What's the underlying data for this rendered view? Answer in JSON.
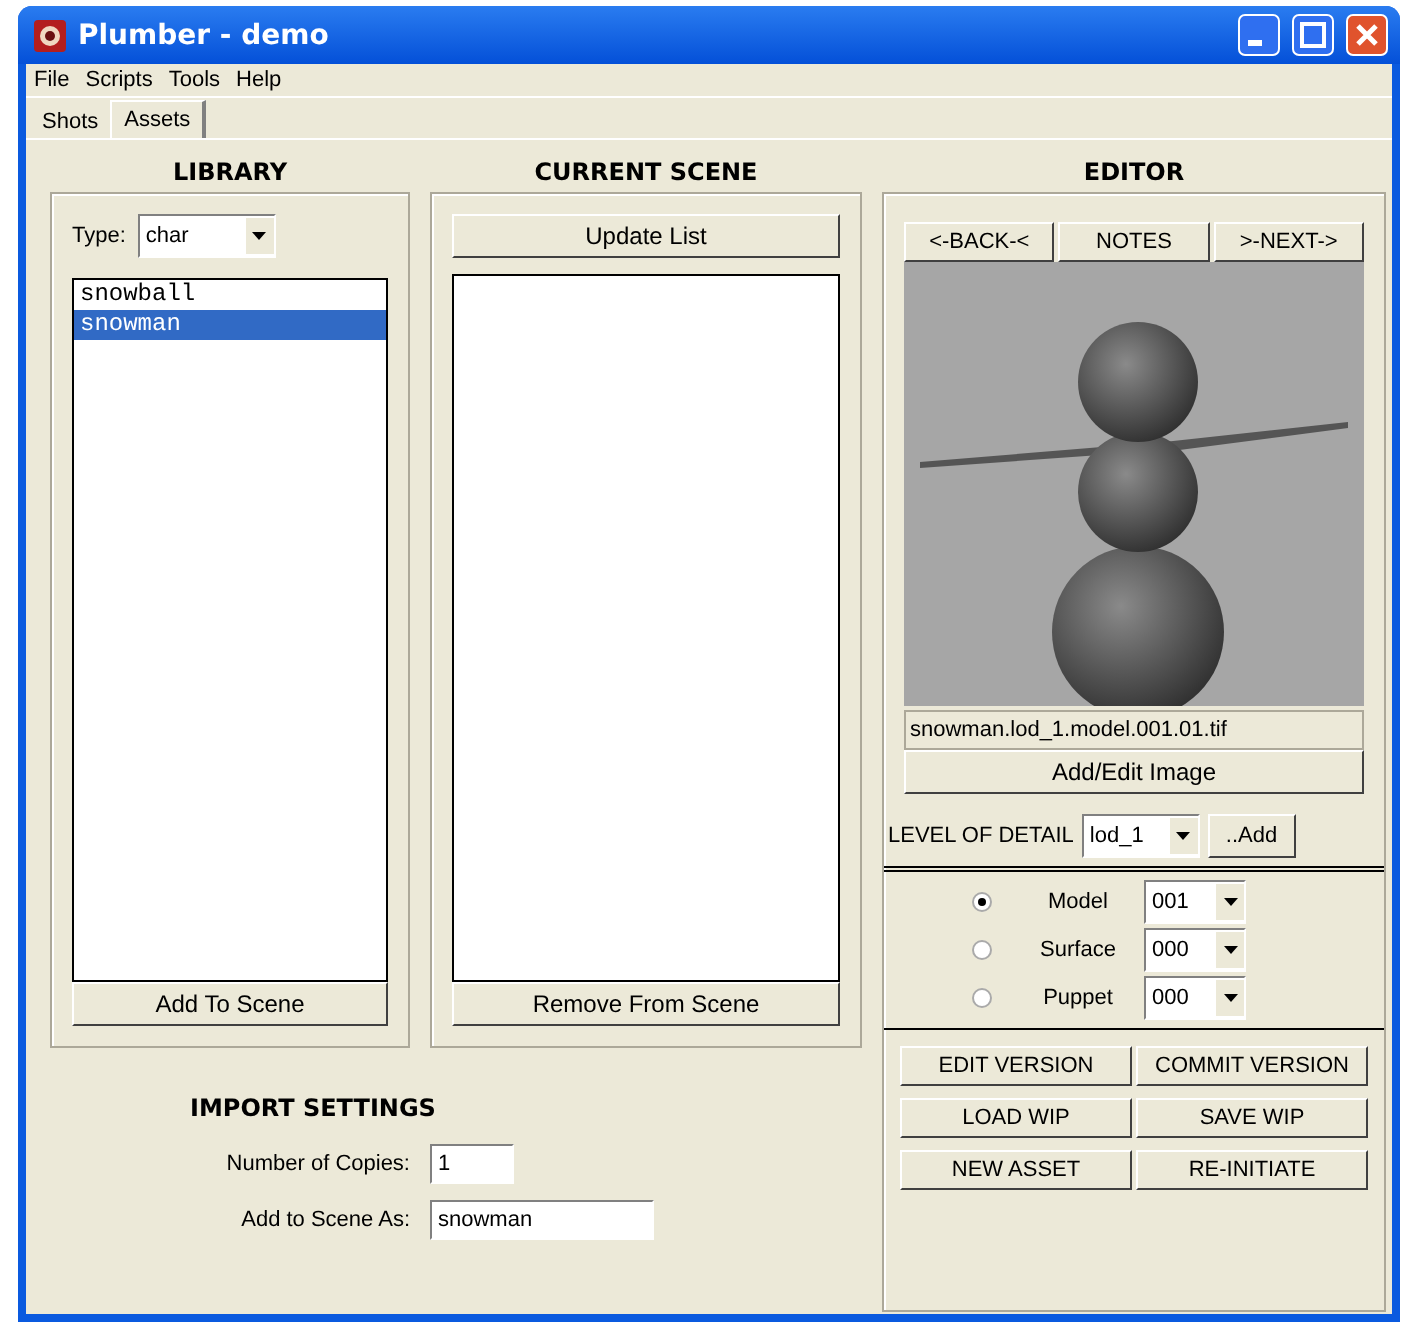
{
  "window": {
    "title": "Plumber - demo"
  },
  "menu": [
    "File",
    "Scripts",
    "Tools",
    "Help"
  ],
  "tabs": [
    {
      "label": "Shots",
      "selected": false
    },
    {
      "label": "Assets",
      "selected": true
    }
  ],
  "library": {
    "heading": "LIBRARY",
    "type_label": "Type:",
    "type_value": "char",
    "items": [
      {
        "label": "snowball",
        "selected": false
      },
      {
        "label": "snowman",
        "selected": true
      }
    ],
    "button": "Add To Scene"
  },
  "current_scene": {
    "heading": "CURRENT SCENE",
    "update_button": "Update List",
    "remove_button": "Remove From Scene"
  },
  "import_settings": {
    "heading": "IMPORT SETTINGS",
    "fields": [
      {
        "label": "Number of Copies:",
        "value": "1",
        "kind": "short"
      },
      {
        "label": "Add to Scene As:",
        "value": "snowman",
        "kind": "long"
      }
    ]
  },
  "editor": {
    "heading": "EDITOR",
    "nav_buttons": [
      "<-BACK-<",
      "NOTES",
      ">-NEXT->"
    ],
    "image": {
      "kind": "picture"
    },
    "image_filename": "snowman.lod_1.model.001.01.tif",
    "image_button": "Add/Edit Image",
    "lod_label": "LEVEL OF DETAIL",
    "lod_value": "lod_1",
    "lod_add_button": "..Add",
    "components": [
      {
        "label": "Model",
        "selected": true,
        "version": "001"
      },
      {
        "label": "Surface",
        "selected": false,
        "version": "000"
      },
      {
        "label": "Puppet",
        "selected": false,
        "version": "000"
      }
    ],
    "action_buttons": [
      "EDIT VERSION",
      "COMMIT VERSION",
      "LOAD WIP",
      "SAVE WIP",
      "NEW ASSET",
      "RE-INITIATE"
    ]
  }
}
